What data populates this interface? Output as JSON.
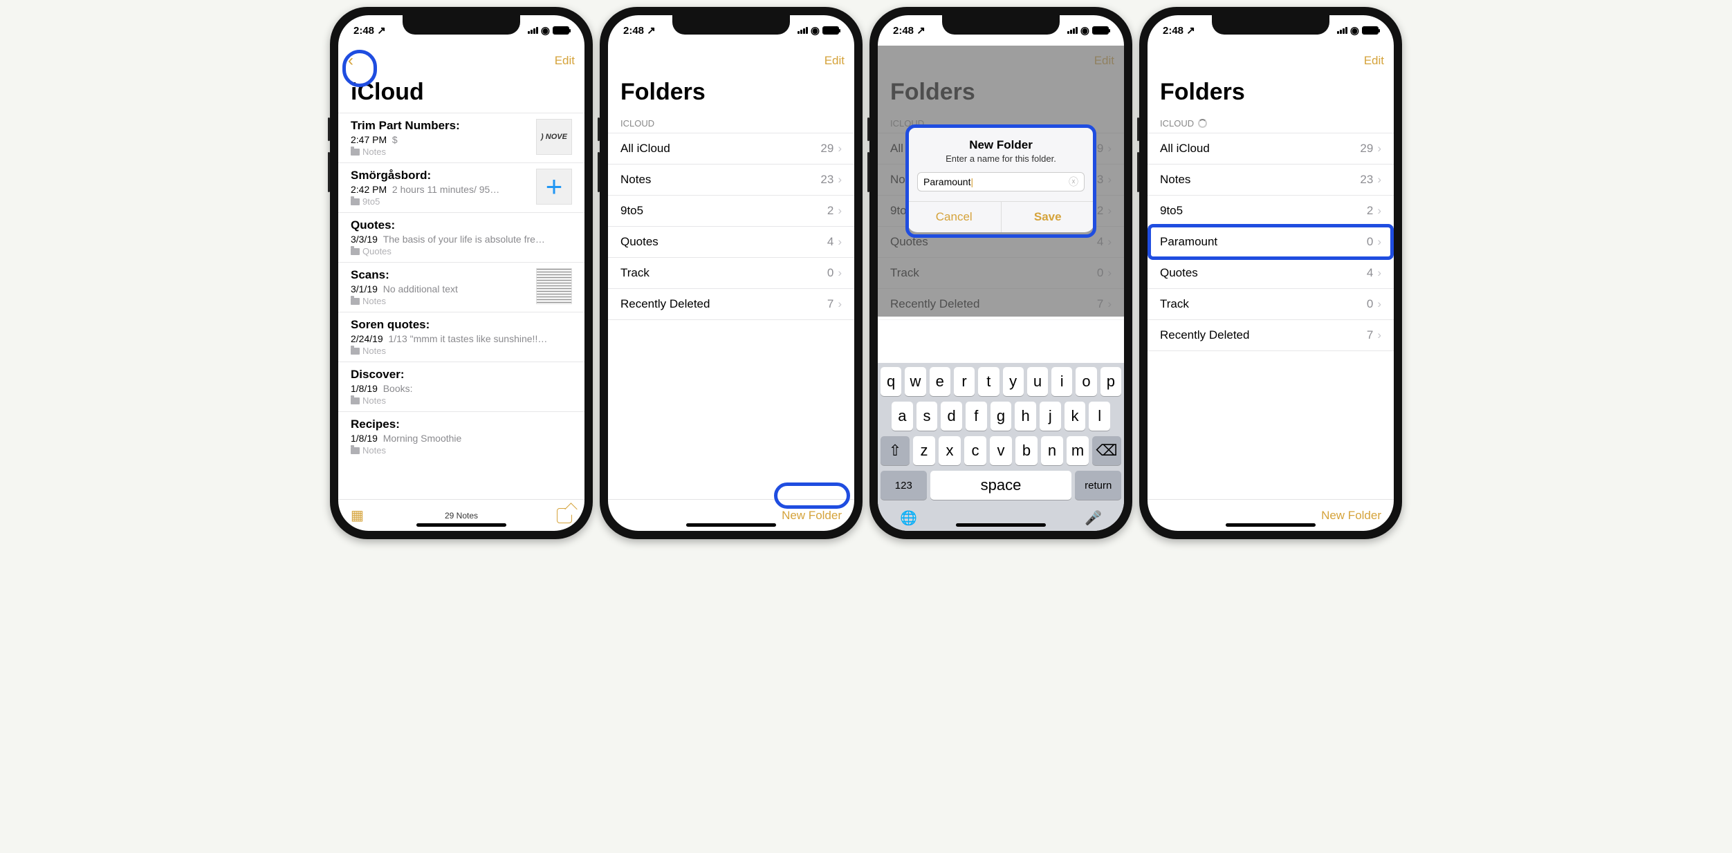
{
  "status": {
    "time": "2:48",
    "arrow": "↗"
  },
  "nav": {
    "edit": "Edit"
  },
  "s1": {
    "title": "iCloud",
    "notes": [
      {
        "title": "Trim Part Numbers:",
        "date": "2:47 PM",
        "sub": "$",
        "folder": "Notes",
        "thumb": "novel"
      },
      {
        "title": "Smörgåsbord:",
        "date": "2:42 PM",
        "sub": "2 hours 11 minutes/ 95…",
        "folder": "9to5",
        "thumb": "plus"
      },
      {
        "title": "Quotes:",
        "date": "3/3/19",
        "sub": "The basis of your life is absolute fre…",
        "folder": "Quotes"
      },
      {
        "title": "Scans:",
        "date": "3/1/19",
        "sub": "No additional text",
        "folder": "Notes",
        "thumb": "scan"
      },
      {
        "title": "Soren quotes:",
        "date": "2/24/19",
        "sub": "1/13 \"mmm it tastes like sunshine!!…",
        "folder": "Notes"
      },
      {
        "title": "Discover:",
        "date": "1/8/19",
        "sub": "Books:",
        "folder": "Notes"
      },
      {
        "title": "Recipes:",
        "date": "1/8/19",
        "sub": "Morning Smoothie",
        "folder": "Notes"
      }
    ],
    "footer": "29 Notes"
  },
  "s2": {
    "title": "Folders",
    "section": "ICLOUD",
    "rows": [
      {
        "name": "All iCloud",
        "count": "29"
      },
      {
        "name": "Notes",
        "count": "23"
      },
      {
        "name": "9to5",
        "count": "2"
      },
      {
        "name": "Quotes",
        "count": "4"
      },
      {
        "name": "Track",
        "count": "0"
      },
      {
        "name": "Recently Deleted",
        "count": "7"
      }
    ],
    "newfolder": "New Folder"
  },
  "s3": {
    "title": "Folders",
    "section": "ICLOUD",
    "rows": [
      {
        "name": "All iCloud",
        "count": "29"
      },
      {
        "name": "Notes",
        "count": "23"
      },
      {
        "name": "9to5",
        "count": "2"
      },
      {
        "name": "Quotes",
        "count": "4"
      },
      {
        "name": "Track",
        "count": "0"
      },
      {
        "name": "Recently Deleted",
        "count": "7"
      }
    ],
    "alert": {
      "title": "New Folder",
      "msg": "Enter a name for this folder.",
      "value": "Paramount",
      "cancel": "Cancel",
      "save": "Save"
    },
    "keys": {
      "r1": [
        "q",
        "w",
        "e",
        "r",
        "t",
        "y",
        "u",
        "i",
        "o",
        "p"
      ],
      "r2": [
        "a",
        "s",
        "d",
        "f",
        "g",
        "h",
        "j",
        "k",
        "l"
      ],
      "r3": [
        "z",
        "x",
        "c",
        "v",
        "b",
        "n",
        "m"
      ],
      "nums": "123",
      "space": "space",
      "ret": "return"
    }
  },
  "s4": {
    "title": "Folders",
    "section": "ICLOUD",
    "rows": [
      {
        "name": "All iCloud",
        "count": "29"
      },
      {
        "name": "Notes",
        "count": "23"
      },
      {
        "name": "9to5",
        "count": "2"
      },
      {
        "name": "Paramount",
        "count": "0",
        "hl": true
      },
      {
        "name": "Quotes",
        "count": "4"
      },
      {
        "name": "Track",
        "count": "0"
      },
      {
        "name": "Recently Deleted",
        "count": "7"
      }
    ],
    "newfolder": "New Folder"
  }
}
